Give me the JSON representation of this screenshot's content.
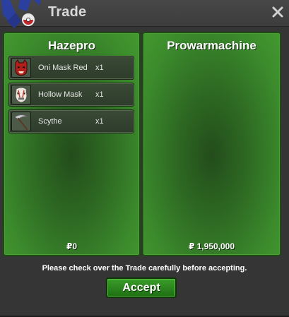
{
  "window": {
    "title": "Trade",
    "close_label": "×"
  },
  "left_player": {
    "name": "Hazepro",
    "money": "₽0",
    "items": [
      {
        "name": "Oni Mask Red",
        "qty": "x1",
        "icon": "oni-mask-red-icon"
      },
      {
        "name": "Hollow Mask",
        "qty": "x1",
        "icon": "hollow-mask-icon"
      },
      {
        "name": "Scythe",
        "qty": "x1",
        "icon": "scythe-icon"
      }
    ]
  },
  "right_player": {
    "name": "Prowarmachine",
    "money": "₽ 1,950,000",
    "items": []
  },
  "footer": {
    "notice": "Please check over the Trade carefully before accepting.",
    "accept_label": "Accept"
  },
  "colors": {
    "panel_green": "#2d6722",
    "panel_border": "#1e4a14",
    "accept_green": "#2b8a1e",
    "window_bg": "#353535"
  }
}
